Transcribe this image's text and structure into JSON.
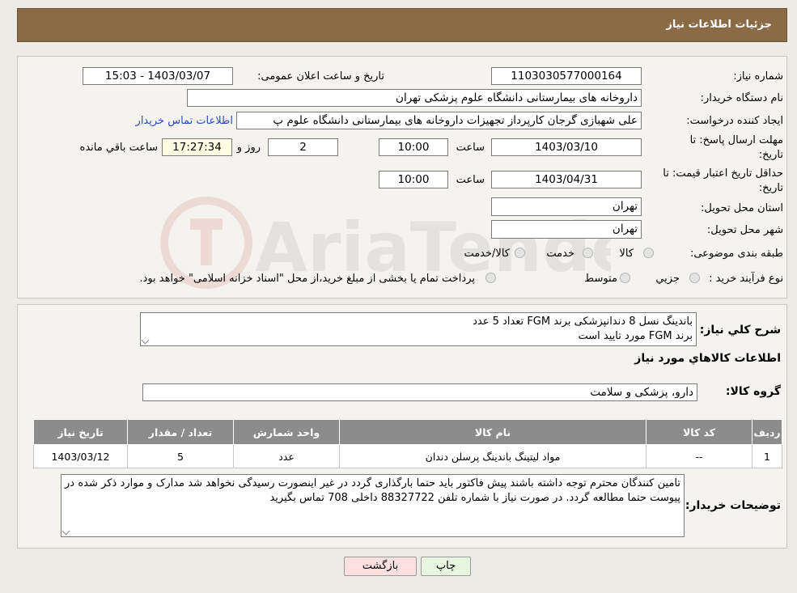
{
  "header": {
    "title": "جزئیات اطلاعات نیاز"
  },
  "form": {
    "need_number_label": "شماره نیاز:",
    "need_number": "1103030577000164",
    "announce_label": "تاریخ و ساعت اعلان عمومی:",
    "announce_value": "1403/03/07 - 15:03",
    "buyer_label": "نام دستگاه خریدار:",
    "buyer_value": "داروخانه های بیمارستانی دانشگاه علوم پزشکی تهران",
    "creator_label": "ایجاد کننده درخواست:",
    "creator_value": "علی شهبازی گرجان کارپرداز تجهیزات داروخانه های بیمارستانی دانشگاه علوم پ",
    "contact_link": "اطلاعات تماس خریدار",
    "deadline_label_1": "مهلت ارسال پاسخ: تا",
    "deadline_label_2": "تاریخ:",
    "deadline_date": "1403/03/10",
    "time_label": "ساعت",
    "deadline_time": "10:00",
    "days_value": "2",
    "days_label": "روز و",
    "remaining_time": "17:27:34",
    "remaining_label": "ساعت باقي مانده",
    "validity_label_1": "حداقل تاریخ اعتبار قیمت: تا",
    "validity_label_2": "تاریخ:",
    "validity_date": "1403/04/31",
    "validity_time": "10:00",
    "province_label": "استان محل تحویل:",
    "province_value": "تهران",
    "city_label": "شهر محل تحویل:",
    "city_value": "تهران",
    "category_label": "طبقه بندی موضوعی:",
    "category_options": [
      "کالا",
      "خدمت",
      "کالا/خدمت"
    ],
    "process_label": "نوع فرآیند خرید :",
    "process_options": [
      "جزيي",
      "متوسط"
    ],
    "process_note": "پرداخت تمام یا بخشی از مبلغ خرید،از محل \"اسناد خزانه اسلامی\" خواهد بود."
  },
  "description": {
    "label": "شرح كلي نياز:",
    "line1": "باندینگ نسل 8 دندانپزشکی برند FGM تعداد 5 عدد",
    "line2": "برند FGM مورد تایید است"
  },
  "goods": {
    "section_title": "اطلاعات کالاهاي مورد نياز",
    "group_label": "گروه کالا:",
    "group_value": "دارو، پزشکی و سلامت"
  },
  "table": {
    "headers": [
      "رديف",
      "کد کالا",
      "نام کالا",
      "واحد شمارش",
      "تعداد / مقدار",
      "تاريخ نياز"
    ],
    "rows": [
      [
        "1",
        "--",
        "مواد لیتینگ باندینگ پرسلن دندان",
        "عدد",
        "5",
        "1403/03/12"
      ]
    ]
  },
  "buyer_notes": {
    "label": "توضیحات خریدار:",
    "text": "تامین کنندگان محترم توجه داشته باشند پیش فاکتور باید حتما بارگذاری گردد در غیر اینصورت رسیدگی نخواهد شد مدارک و موارد ذکر شده در پیوست حتما مطالعه گردد. در صورت نیاز با شماره تلفن 88327722 داخلی 708 تماس بگیرید"
  },
  "buttons": {
    "print": "چاپ",
    "back": "بازگشت"
  },
  "watermark": {
    "text": "AriaTender.neT"
  },
  "colors": {
    "header_bg": "#8b6b45",
    "link": "#2a4bb5",
    "back_button": "#fbe0e0",
    "print_button": "#e6f6df"
  }
}
